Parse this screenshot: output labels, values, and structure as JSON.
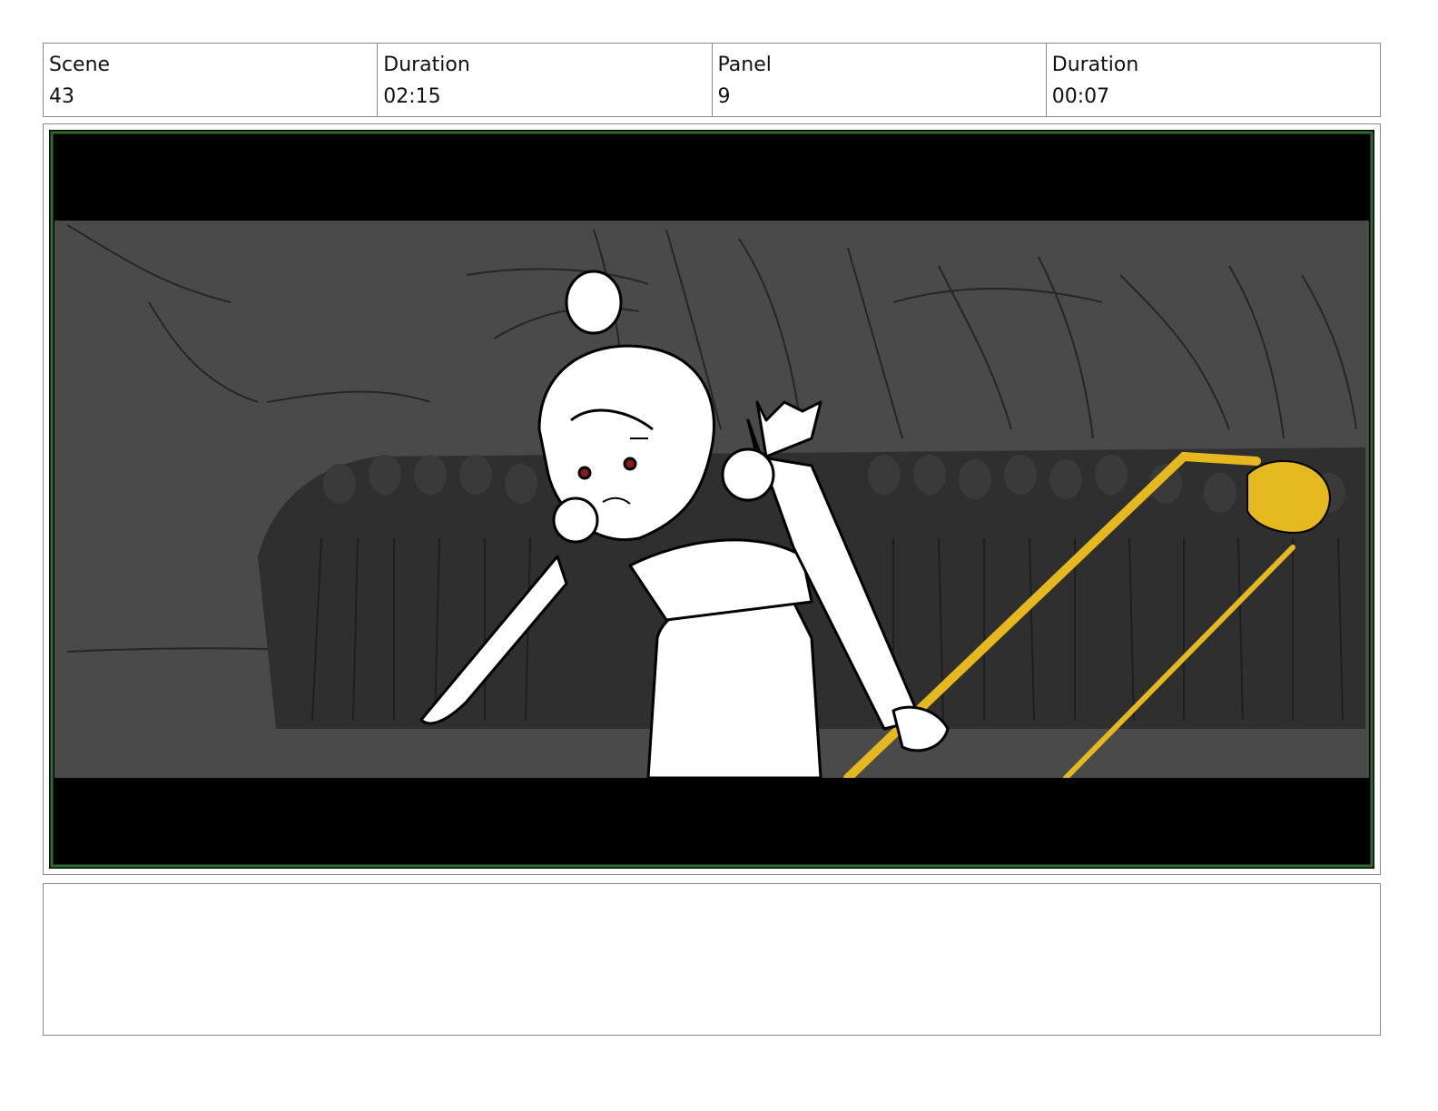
{
  "header": {
    "scene": {
      "label": "Scene",
      "value": "43"
    },
    "scene_duration": {
      "label": "Duration",
      "value": "02:15"
    },
    "panel": {
      "label": "Panel",
      "value": "9"
    },
    "panel_duration": {
      "label": "Duration",
      "value": "00:07"
    }
  },
  "panel_image": {
    "icon": "storyboard-sketch",
    "colors": {
      "letterbox": "#000000",
      "background": "#4a4a4a",
      "crowd": "#2f2f2f",
      "frame_border": "#2f6b2f",
      "staff": "#e6b820",
      "character_fill": "#ffffff",
      "eyes": "#8b1a1a"
    }
  },
  "notes": {
    "text": ""
  }
}
